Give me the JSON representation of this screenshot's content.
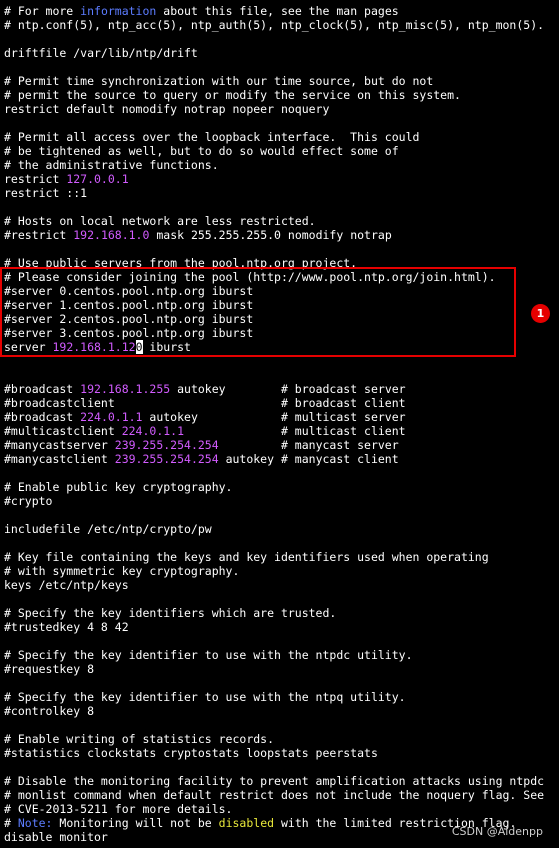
{
  "colors": {
    "background": "#000000",
    "text": "#ffffff",
    "keyword_blue": "#5c7cff",
    "value_magenta": "#d25cff",
    "warning_yellow": "#e8e83a",
    "annotation_red": "#e60000"
  },
  "lines": [
    [
      {
        "t": "# For more "
      },
      {
        "t": "information",
        "c": "blue"
      },
      {
        "t": " about this file, see the man pages"
      }
    ],
    [
      {
        "t": "# ntp.conf(5), ntp_acc(5), ntp_auth(5), ntp_clock(5), ntp_misc(5), ntp_mon(5)."
      }
    ],
    [
      {
        "t": ""
      }
    ],
    [
      {
        "t": "driftfile /var/lib/ntp/drift"
      }
    ],
    [
      {
        "t": ""
      }
    ],
    [
      {
        "t": "# Permit time synchronization with our time source, but do not"
      }
    ],
    [
      {
        "t": "# permit the source to query or modify the service on this system."
      }
    ],
    [
      {
        "t": "restrict default nomodify notrap nopeer noquery"
      }
    ],
    [
      {
        "t": ""
      }
    ],
    [
      {
        "t": "# Permit all access over the loopback interface.  This could"
      }
    ],
    [
      {
        "t": "# be tightened as well, but to do so would effect some of"
      }
    ],
    [
      {
        "t": "# the administrative functions."
      }
    ],
    [
      {
        "t": "restrict "
      },
      {
        "t": "127.0.0.1",
        "c": "magenta"
      }
    ],
    [
      {
        "t": "restrict ::1"
      }
    ],
    [
      {
        "t": ""
      }
    ],
    [
      {
        "t": "# Hosts on local network are less restricted."
      }
    ],
    [
      {
        "t": "#restrict "
      },
      {
        "t": "192.168.1.0",
        "c": "magenta"
      },
      {
        "t": " mask 255.255.255.0 nomodify notrap"
      }
    ],
    [
      {
        "t": ""
      }
    ],
    [
      {
        "t": "# Use public servers from the pool.ntp.org project."
      }
    ],
    [
      {
        "t": "# Please consider joining the pool (http://www.pool.ntp.org/join.html)."
      }
    ],
    [
      {
        "t": "#server 0.centos.pool.ntp.org iburst"
      }
    ],
    [
      {
        "t": "#server 1.centos.pool.ntp.org iburst"
      }
    ],
    [
      {
        "t": "#server 2.centos.pool.ntp.org iburst"
      }
    ],
    [
      {
        "t": "#server 3.centos.pool.ntp.org iburst"
      }
    ],
    [
      {
        "t": "server "
      },
      {
        "t": "192.168.1.12",
        "c": "magenta"
      },
      {
        "t": "0",
        "c": "cursor"
      },
      {
        "t": " iburst"
      }
    ],
    [
      {
        "t": ""
      }
    ],
    [
      {
        "t": ""
      }
    ],
    [
      {
        "t": "#broadcast "
      },
      {
        "t": "192.168.1.255",
        "c": "magenta"
      },
      {
        "t": " autokey        # broadcast server"
      }
    ],
    [
      {
        "t": "#broadcastclient                        # broadcast client"
      }
    ],
    [
      {
        "t": "#broadcast "
      },
      {
        "t": "224.0.1.1",
        "c": "magenta"
      },
      {
        "t": " autokey            # multicast server"
      }
    ],
    [
      {
        "t": "#multicastclient "
      },
      {
        "t": "224.0.1.1",
        "c": "magenta"
      },
      {
        "t": "              # multicast client"
      }
    ],
    [
      {
        "t": "#manycastserver "
      },
      {
        "t": "239.255.254.254",
        "c": "magenta"
      },
      {
        "t": "         # manycast server"
      }
    ],
    [
      {
        "t": "#manycastclient "
      },
      {
        "t": "239.255.254.254",
        "c": "magenta"
      },
      {
        "t": " autokey # manycast client"
      }
    ],
    [
      {
        "t": ""
      }
    ],
    [
      {
        "t": "# Enable public key cryptography."
      }
    ],
    [
      {
        "t": "#crypto"
      }
    ],
    [
      {
        "t": ""
      }
    ],
    [
      {
        "t": "includefile /etc/ntp/crypto/pw"
      }
    ],
    [
      {
        "t": ""
      }
    ],
    [
      {
        "t": "# Key file containing the keys and key identifiers used when operating"
      }
    ],
    [
      {
        "t": "# with symmetric key cryptography."
      }
    ],
    [
      {
        "t": "keys /etc/ntp/keys"
      }
    ],
    [
      {
        "t": ""
      }
    ],
    [
      {
        "t": "# Specify the key identifiers which are trusted."
      }
    ],
    [
      {
        "t": "#trustedkey 4 8 42"
      }
    ],
    [
      {
        "t": ""
      }
    ],
    [
      {
        "t": "# Specify the key identifier to use with the ntpdc utility."
      }
    ],
    [
      {
        "t": "#requestkey 8"
      }
    ],
    [
      {
        "t": ""
      }
    ],
    [
      {
        "t": "# Specify the key identifier to use with the ntpq utility."
      }
    ],
    [
      {
        "t": "#controlkey 8"
      }
    ],
    [
      {
        "t": ""
      }
    ],
    [
      {
        "t": "# Enable writing of statistics records."
      }
    ],
    [
      {
        "t": "#statistics clockstats cryptostats loopstats peerstats"
      }
    ],
    [
      {
        "t": ""
      }
    ],
    [
      {
        "t": "# Disable the monitoring facility to prevent amplification attacks using ntpdc"
      }
    ],
    [
      {
        "t": "# monlist command when default restrict does not include the noquery flag. See"
      }
    ],
    [
      {
        "t": "# CVE-2013-5211 for more details."
      }
    ],
    [
      {
        "t": "# "
      },
      {
        "t": "Note:",
        "c": "blue"
      },
      {
        "t": " Monitoring will not be "
      },
      {
        "t": "disabled",
        "c": "yellow"
      },
      {
        "t": " with the limited restriction flag."
      }
    ],
    [
      {
        "t": "disable monitor"
      }
    ]
  ],
  "annotation": {
    "badge_number": "1"
  },
  "watermark": "CSDN @Aidenpp"
}
